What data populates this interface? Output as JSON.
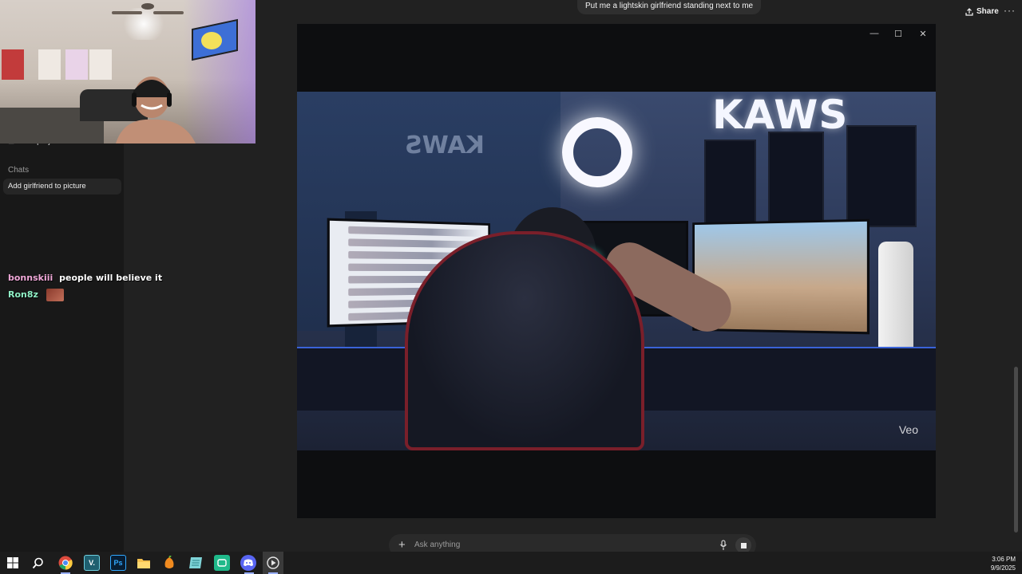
{
  "header": {
    "prompt_bubble": "Put me a lightskin girlfriend standing next to me",
    "share_label": "Share",
    "more_label": "···"
  },
  "sidebar": {
    "new_project_label": "New project",
    "chats_heading": "Chats",
    "chat_items": [
      "Add girlfriend to picture"
    ]
  },
  "stream_chat": [
    {
      "user": "bonnskiii",
      "message": "people will believe it",
      "user_color": "#f0a8d8"
    },
    {
      "user": "Ron8z",
      "message": "",
      "user_color": "#8ff0c5",
      "emote": "emote-image"
    }
  ],
  "video_modal": {
    "controls": [
      "minimize",
      "maximize",
      "close"
    ],
    "watermark": "Veo",
    "sign_text_big": "KAWS",
    "sign_text_small": "KAWS"
  },
  "composer": {
    "placeholder": "Ask anything"
  },
  "taskbar": {
    "apps": [
      "windows-start",
      "search",
      "chrome",
      "vegas",
      "photoshop",
      "file-explorer",
      "fl-studio",
      "notes",
      "cap-cut",
      "discord",
      "media-player"
    ],
    "time": "3:06 PM",
    "date": "9/9/2025"
  },
  "colors": {
    "background": "#212121",
    "sidebar": "#181818",
    "modal": "#0d0e10",
    "chat_user1": "#f0a8d8",
    "chat_user2": "#8ff0c5"
  }
}
